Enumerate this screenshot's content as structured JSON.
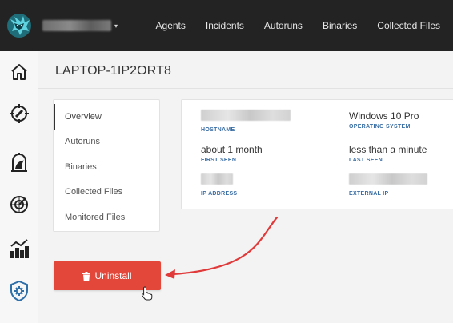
{
  "topbar": {
    "logo": "wolf-logo-icon",
    "org_select": {
      "value": "",
      "caret": "▾"
    },
    "nav": [
      "Agents",
      "Incidents",
      "Autoruns",
      "Binaries",
      "Collected Files"
    ]
  },
  "rail": {
    "icons": [
      "home-icon",
      "radar-crosshair-icon",
      "birdcage-icon",
      "radar-icon",
      "chart-trend-icon",
      "shield-gear-icon"
    ]
  },
  "page": {
    "title": "LAPTOP-1IP2ORT8"
  },
  "side_menu": {
    "items": [
      "Overview",
      "Autoruns",
      "Binaries",
      "Collected Files",
      "Monitored Files"
    ],
    "active": "Overview"
  },
  "info": {
    "hostname": {
      "value": "",
      "label": "HOSTNAME"
    },
    "os": {
      "value": "Windows 10 Pro",
      "label": "OPERATING SYSTEM"
    },
    "first_seen": {
      "value": "about 1 month",
      "label": "FIRST SEEN"
    },
    "last_seen": {
      "value": "less than a minute",
      "label": "LAST SEEN"
    },
    "ip": {
      "value": "",
      "label": "IP ADDRESS"
    },
    "external_ip": {
      "value": "",
      "label": "EXTERNAL IP"
    }
  },
  "actions": {
    "uninstall_label": "Uninstall",
    "uninstall_icon": "trash-icon"
  },
  "colors": {
    "topbar": "#232323",
    "danger": "#e2473a",
    "label_blue": "#3a6ea5",
    "annotation_arrow": "#e03a3a"
  }
}
